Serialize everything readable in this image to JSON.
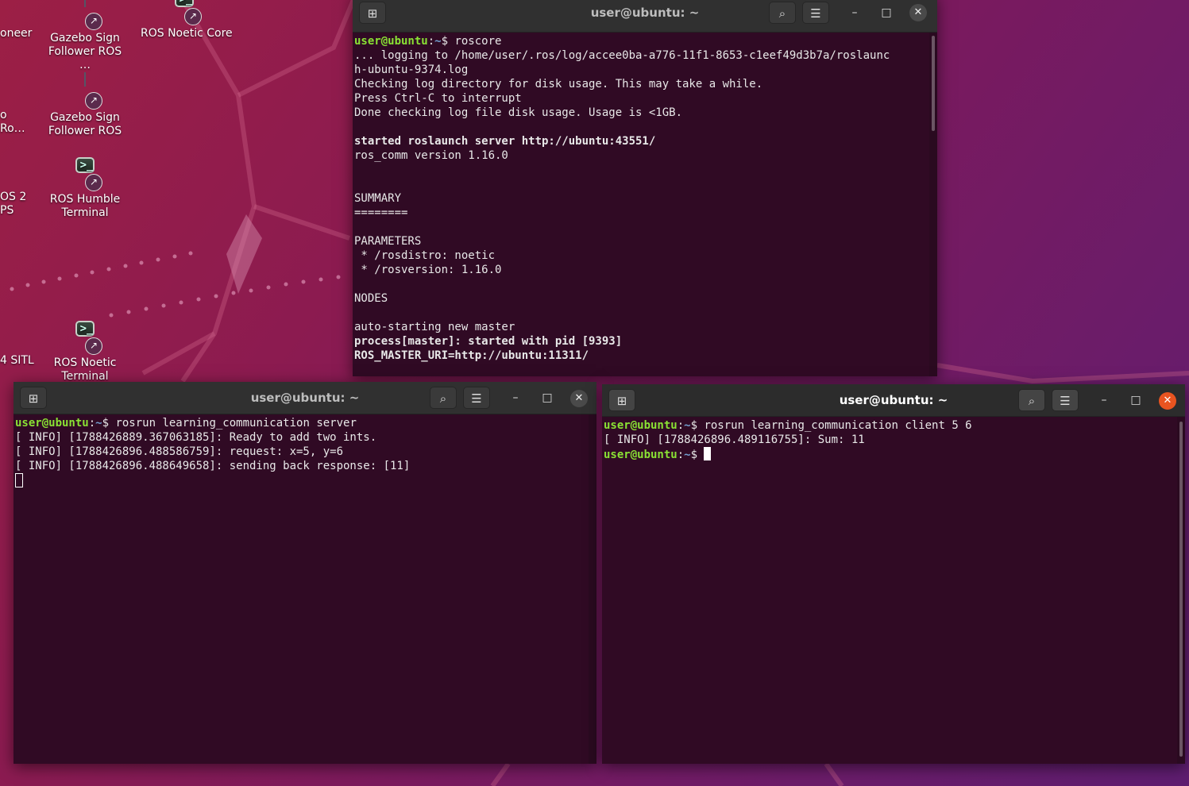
{
  "desktop": {
    "icons": [
      {
        "label": "Gazebo Sign Follower ROS …",
        "kind": "gazebo"
      },
      {
        "label": "ROS Noetic Core",
        "kind": "terminal"
      },
      {
        "label": "Gazebo Sign Follower ROS",
        "kind": "gazebo"
      },
      {
        "label": "ROS Humble Terminal",
        "kind": "terminal"
      },
      {
        "label": "ROS Noetic Terminal",
        "kind": "terminal"
      }
    ],
    "edge_labels": [
      "oneer",
      "o",
      "Ro…",
      "OS 2",
      "PS",
      "4 SITL"
    ],
    "term_glyph": ">_",
    "badge_glyph": "↗"
  },
  "roscore_window": {
    "title": "user@ubuntu: ~",
    "lines": [
      {
        "segs": [
          {
            "t": "user@ubuntu",
            "c": "prompt-user"
          },
          {
            "t": ":",
            "c": ""
          },
          {
            "t": "~",
            "c": "prompt-path"
          },
          {
            "t": "$ roscore",
            "c": ""
          }
        ]
      },
      {
        "segs": [
          {
            "t": "... logging to /home/user/.ros/log/accee0ba-a776-11f1-8653-c1eef49d3b7a/roslaunc",
            "c": ""
          }
        ]
      },
      {
        "segs": [
          {
            "t": "h-ubuntu-9374.log",
            "c": ""
          }
        ]
      },
      {
        "segs": [
          {
            "t": "Checking log directory for disk usage. This may take a while.",
            "c": ""
          }
        ]
      },
      {
        "segs": [
          {
            "t": "Press Ctrl-C to interrupt",
            "c": ""
          }
        ]
      },
      {
        "segs": [
          {
            "t": "Done checking log file disk usage. Usage is <1GB.",
            "c": ""
          }
        ]
      },
      {
        "segs": []
      },
      {
        "segs": [
          {
            "t": "started roslaunch server http://ubuntu:43551/",
            "c": "b"
          }
        ]
      },
      {
        "segs": [
          {
            "t": "ros_comm version 1.16.0",
            "c": ""
          }
        ]
      },
      {
        "segs": []
      },
      {
        "segs": []
      },
      {
        "segs": [
          {
            "t": "SUMMARY",
            "c": ""
          }
        ]
      },
      {
        "segs": [
          {
            "t": "========",
            "c": ""
          }
        ]
      },
      {
        "segs": []
      },
      {
        "segs": [
          {
            "t": "PARAMETERS",
            "c": ""
          }
        ]
      },
      {
        "segs": [
          {
            "t": " * /rosdistro: noetic",
            "c": ""
          }
        ]
      },
      {
        "segs": [
          {
            "t": " * /rosversion: 1.16.0",
            "c": ""
          }
        ]
      },
      {
        "segs": []
      },
      {
        "segs": [
          {
            "t": "NODES",
            "c": ""
          }
        ]
      },
      {
        "segs": []
      },
      {
        "segs": [
          {
            "t": "auto-starting new master",
            "c": ""
          }
        ]
      },
      {
        "segs": [
          {
            "t": "process[master]: started with pid [9393]",
            "c": "b"
          }
        ]
      },
      {
        "segs": [
          {
            "t": "ROS_MASTER_URI=http://ubuntu:11311/",
            "c": "b"
          }
        ]
      }
    ]
  },
  "server_window": {
    "title": "user@ubuntu: ~",
    "lines": [
      {
        "segs": [
          {
            "t": "user@ubuntu",
            "c": "prompt-user"
          },
          {
            "t": ":",
            "c": ""
          },
          {
            "t": "~",
            "c": "prompt-path"
          },
          {
            "t": "$ rosrun learning_communication server",
            "c": ""
          }
        ]
      },
      {
        "segs": [
          {
            "t": "[ INFO] [1788426889.367063185]: Ready to add two ints.",
            "c": ""
          }
        ]
      },
      {
        "segs": [
          {
            "t": "[ INFO] [1788426896.488586759]: request: x=5, y=6",
            "c": ""
          }
        ]
      },
      {
        "segs": [
          {
            "t": "[ INFO] [1788426896.488649658]: sending back response: [11]",
            "c": ""
          }
        ]
      }
    ]
  },
  "client_window": {
    "title": "user@ubuntu: ~",
    "lines": [
      {
        "segs": [
          {
            "t": "user@ubuntu",
            "c": "prompt-user"
          },
          {
            "t": ":",
            "c": ""
          },
          {
            "t": "~",
            "c": "prompt-path"
          },
          {
            "t": "$ rosrun learning_communication client 5 6",
            "c": ""
          }
        ]
      },
      {
        "segs": [
          {
            "t": "[ INFO] [1788426896.489116755]: Sum: 11",
            "c": ""
          }
        ]
      },
      {
        "segs": [
          {
            "t": "user@ubuntu",
            "c": "prompt-user"
          },
          {
            "t": ":",
            "c": ""
          },
          {
            "t": "~",
            "c": "prompt-path"
          },
          {
            "t": "$ ",
            "c": ""
          }
        ]
      }
    ]
  },
  "buttons": {
    "new_tab": "⊞",
    "search": "⌕",
    "menu": "☰",
    "minimize": "–",
    "maximize": "□",
    "close": "✕"
  }
}
